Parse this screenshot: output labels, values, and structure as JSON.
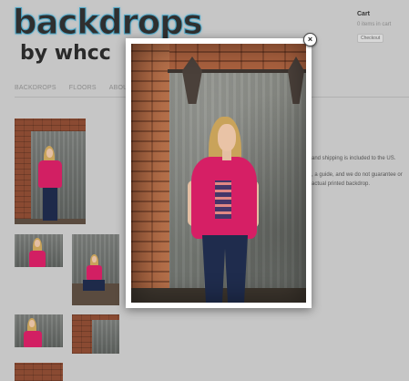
{
  "brand": {
    "logo_main": "backdrops",
    "logo_sub": "by whcc",
    "accent": "#4aa3c3"
  },
  "cart": {
    "title": "Cart",
    "count_text": "0 items in cart",
    "checkout_label": "Checkout"
  },
  "nav": {
    "items": [
      {
        "label": "BACKDROPS"
      },
      {
        "label": "FLOORS"
      },
      {
        "label": "ABOUT U"
      }
    ]
  },
  "description": {
    "line1": "and shipping is included to the US.",
    "line2": ", a guide, and we do not guarantee or",
    "line3": "actual printed backdrop."
  },
  "modal": {
    "close_label": "×",
    "shirt_color": "#d61f65"
  }
}
